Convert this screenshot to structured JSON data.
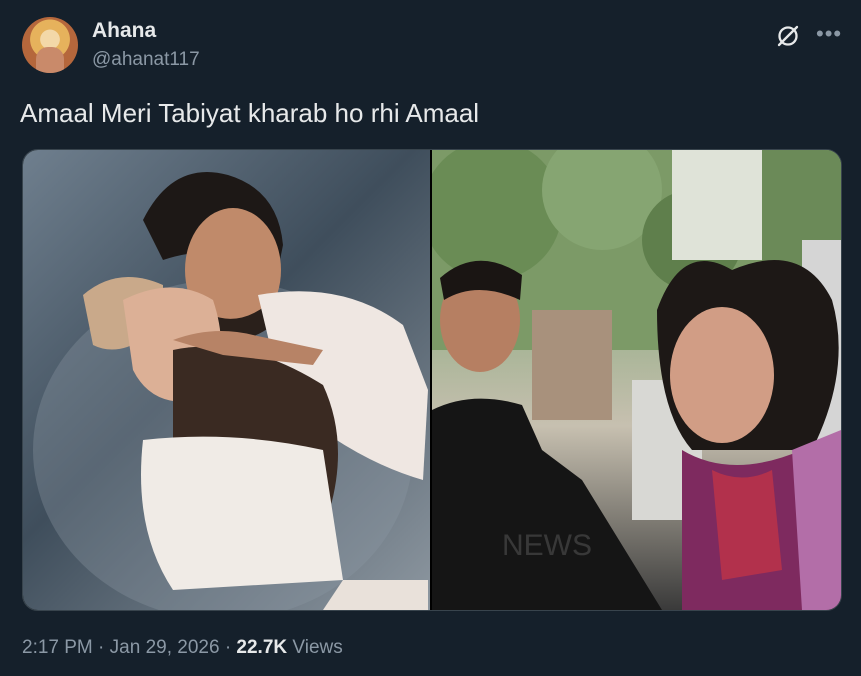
{
  "author": {
    "name": "Ahana",
    "handle": "@ahanat117"
  },
  "tweet": {
    "text": "Amaal Meri Tabiyat kharab ho rhi Amaal"
  },
  "media": {
    "left_image": "couple-photo",
    "right_image": "street-photo-two-people",
    "watermark": "NEWS"
  },
  "meta": {
    "time": "2:17 PM",
    "separator1": "·",
    "date": "Jan 29, 2026",
    "separator2": "·",
    "views_count": "22.7K",
    "views_label": "Views"
  },
  "icons": {
    "grok": "grok-icon",
    "more": "more-icon"
  },
  "colors": {
    "background": "#15202b",
    "text_primary": "#e7e9ea",
    "text_secondary": "#8b98a5",
    "border": "#38444d"
  }
}
